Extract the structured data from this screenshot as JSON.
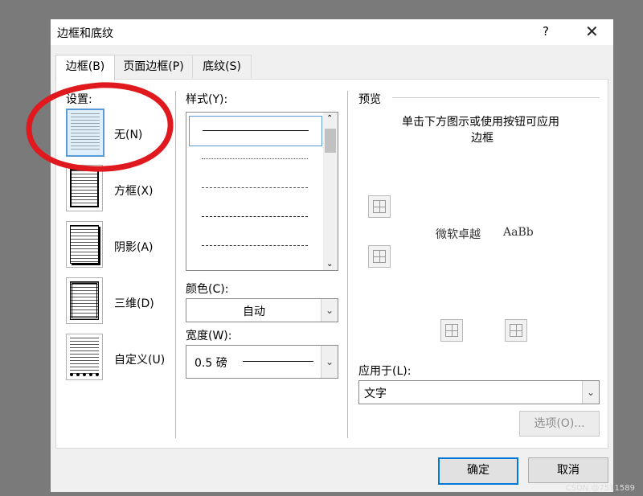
{
  "window": {
    "title": "边框和底纹",
    "help": "?",
    "close": "✕"
  },
  "tabs": [
    {
      "label": "边框(B)",
      "active": true
    },
    {
      "label": "页面边框(P)",
      "active": false
    },
    {
      "label": "底纹(S)",
      "active": false
    }
  ],
  "settings": {
    "heading": "设置:",
    "items": [
      {
        "label": "无(N)",
        "selected": true
      },
      {
        "label": "方框(X)"
      },
      {
        "label": "阴影(A)"
      },
      {
        "label": "三维(D)"
      },
      {
        "label": "自定义(U)"
      }
    ]
  },
  "style": {
    "heading": "样式(Y):",
    "items": [
      "solid",
      "dotted",
      "dashed-fine",
      "dashed",
      "dash-dot"
    ]
  },
  "color": {
    "label": "颜色(C):",
    "value": "自动"
  },
  "width": {
    "label": "宽度(W):",
    "value": "0.5 磅"
  },
  "preview": {
    "heading": "预览",
    "hint_line1": "单击下方图示或使用按钮可应用",
    "hint_line2": "边框",
    "sample_cn": "微软卓越",
    "sample_en": "AaBb"
  },
  "apply_to": {
    "label": "应用于(L):",
    "value": "文字"
  },
  "buttons": {
    "options": "选项(O)...",
    "ok": "确定",
    "cancel": "取消"
  },
  "watermark": "CSDN @7511589",
  "annotation_color": "#e0191f",
  "accent": "#0078d7"
}
